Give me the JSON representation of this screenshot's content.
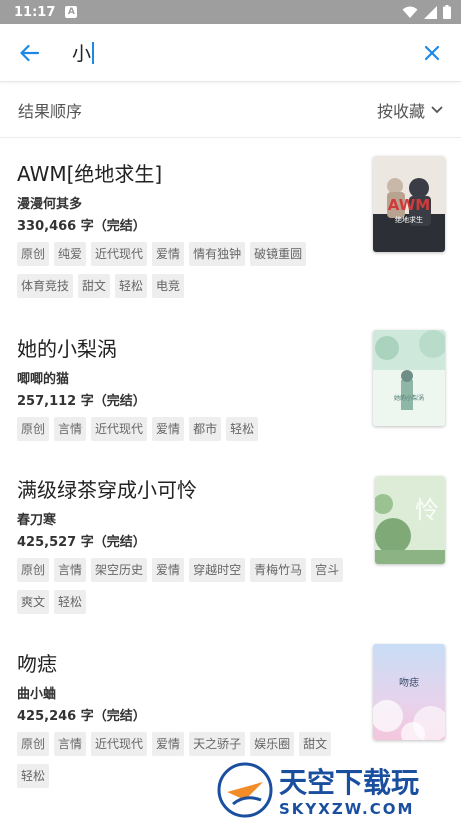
{
  "status": {
    "time": "11:17",
    "notif": "A"
  },
  "search": {
    "query": "小"
  },
  "sort": {
    "label": "结果顺序",
    "order": "按收藏"
  },
  "books": [
    {
      "title": "AWM[绝地求生]",
      "author": "漫漫何其多",
      "count": "330,466 字（完结）",
      "tags": [
        "原创",
        "纯爱",
        "近代现代",
        "爱情",
        "情有独钟",
        "破镜重圆",
        "体育竞技",
        "甜文",
        "轻松",
        "电竞"
      ],
      "cover_title": "AWM",
      "cover_sub": "绝地求生",
      "cover_colors": [
        "#e9e4de",
        "#2b2d33"
      ]
    },
    {
      "title": "她的小梨涡",
      "author": "唧唧的猫",
      "count": "257,112 字（完结）",
      "tags": [
        "原创",
        "言情",
        "近代现代",
        "爱情",
        "都市",
        "轻松"
      ],
      "cover_title": "她的小梨涡",
      "cover_colors": [
        "#e6f2ea",
        "#9cc9b6"
      ]
    },
    {
      "title": "满级绿茶穿成小可怜",
      "author": "春刀寒",
      "count": "425,527 字（完结）",
      "tags": [
        "原创",
        "言情",
        "架空历史",
        "爱情",
        "穿越时空",
        "青梅竹马",
        "宫斗",
        "爽文",
        "轻松"
      ],
      "cover_title": "怜",
      "cover_colors": [
        "#d8ead2",
        "#6e9a63"
      ]
    },
    {
      "title": "吻痣",
      "author": "曲小蛐",
      "count": "425,246 字（完结）",
      "tags": [
        "原创",
        "言情",
        "近代现代",
        "爱情",
        "天之骄子",
        "娱乐圈",
        "甜文",
        "轻松"
      ],
      "cover_title": "吻痣",
      "cover_colors": [
        "#cfe2f7",
        "#f1c9e0"
      ]
    }
  ],
  "watermark": {
    "main": "天空下载玩",
    "sub": "SKYXZW.COM"
  },
  "colors": {
    "accent": "#1e88e5",
    "tag_bg": "#eeeeee",
    "status_bg": "#9e9e9e"
  }
}
